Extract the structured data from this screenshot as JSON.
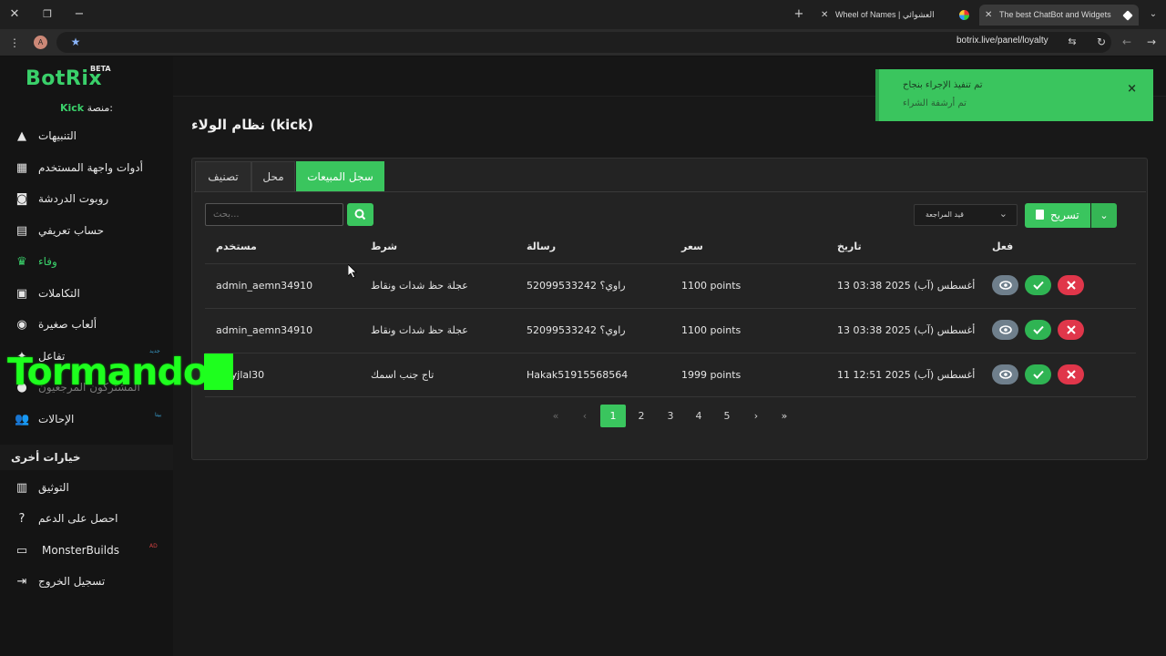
{
  "browser": {
    "tabs": [
      {
        "title": "Wheel of Names | العشوائي",
        "active": false
      },
      {
        "title": "The best ChatBot and Widgets",
        "active": true
      }
    ],
    "profile_initial": "A",
    "url": "botrix.live/panel/loyalty"
  },
  "app": {
    "logo": "BotRix",
    "beta": "BETA",
    "platform_label": "منصة:",
    "platform_value": "Kick"
  },
  "sidebar": {
    "items": [
      {
        "label": "التنبيهات",
        "icon": "warning-icon"
      },
      {
        "label": "أدوات واجهة المستخدم",
        "icon": "grid-icon"
      },
      {
        "label": "روبوت الدردشة",
        "icon": "robot-icon"
      },
      {
        "label": "حساب تعريفي",
        "icon": "id-card-icon"
      },
      {
        "label": "وفاء",
        "icon": "trophy-icon",
        "active": true
      },
      {
        "label": "التكاملات",
        "icon": "plugin-icon"
      },
      {
        "label": "ألعاب صغيرة",
        "icon": "gamepad-icon"
      },
      {
        "label": "تفاعل",
        "icon": "interact-icon",
        "badge": "جديد"
      },
      {
        "label": "المشتركون المرجعيون",
        "icon": "users-icon"
      },
      {
        "label": "الإحالات",
        "icon": "referrals-icon",
        "badge": "بيتا"
      }
    ],
    "section_title": "خيارات أخرى",
    "other_items": [
      {
        "label": "التوثيق",
        "icon": "book-icon"
      },
      {
        "label": "احصل على الدعم",
        "icon": "help-icon"
      },
      {
        "label": "MonsterBuilds",
        "icon": "monitor-icon",
        "badge": "AD"
      },
      {
        "label": "تسجيل الخروج",
        "icon": "logout-icon"
      }
    ]
  },
  "main": {
    "title": "نظام الولاء (kick)",
    "tabs": [
      {
        "label": "سجل المبيعات",
        "active": true
      },
      {
        "label": "محل",
        "active": false
      },
      {
        "label": "تصنيف",
        "active": false
      }
    ],
    "search_placeholder": "بحث...",
    "filter_selected": "قيد المراجعة",
    "export_label": "تسريح",
    "table": {
      "headers": [
        "مستخدم",
        "شرط",
        "رسالة",
        "سعر",
        "تاريخ",
        "فعل"
      ],
      "rows": [
        {
          "user": "admin_aemn34910",
          "condition": "عجلة حظ شدات ونقاط",
          "message": "راوي؟ 52099533242",
          "price": "1100 points",
          "date": "13 أغسطس (آب) 2025 03:38"
        },
        {
          "user": "admin_aemn34910",
          "condition": "عجلة حظ شدات ونقاط",
          "message": "راوي؟ 52099533242",
          "price": "1100 points",
          "date": "13 أغسطس (آب) 2025 03:38"
        },
        {
          "user": "syryjlal30",
          "condition": "تاج جنب اسمك",
          "message": "Hakak51915568564",
          "price": "1999 points",
          "date": "11 أغسطس (آب) 2025 12:51"
        }
      ]
    },
    "pagination": {
      "first": "«",
      "prev": "‹",
      "pages": [
        "1",
        "2",
        "3",
        "4",
        "5"
      ],
      "current": "1",
      "next": "›",
      "last": "»"
    }
  },
  "toast": {
    "title": "تم تنفيذ الإجراء بنجاح",
    "message": "تم أرشفة الشراء",
    "close": "×"
  },
  "overlay": {
    "watermark_text": "Tormando"
  },
  "colors": {
    "accent": "#3ac55e",
    "danger": "#e0364a",
    "view": "#6f7f8c"
  }
}
